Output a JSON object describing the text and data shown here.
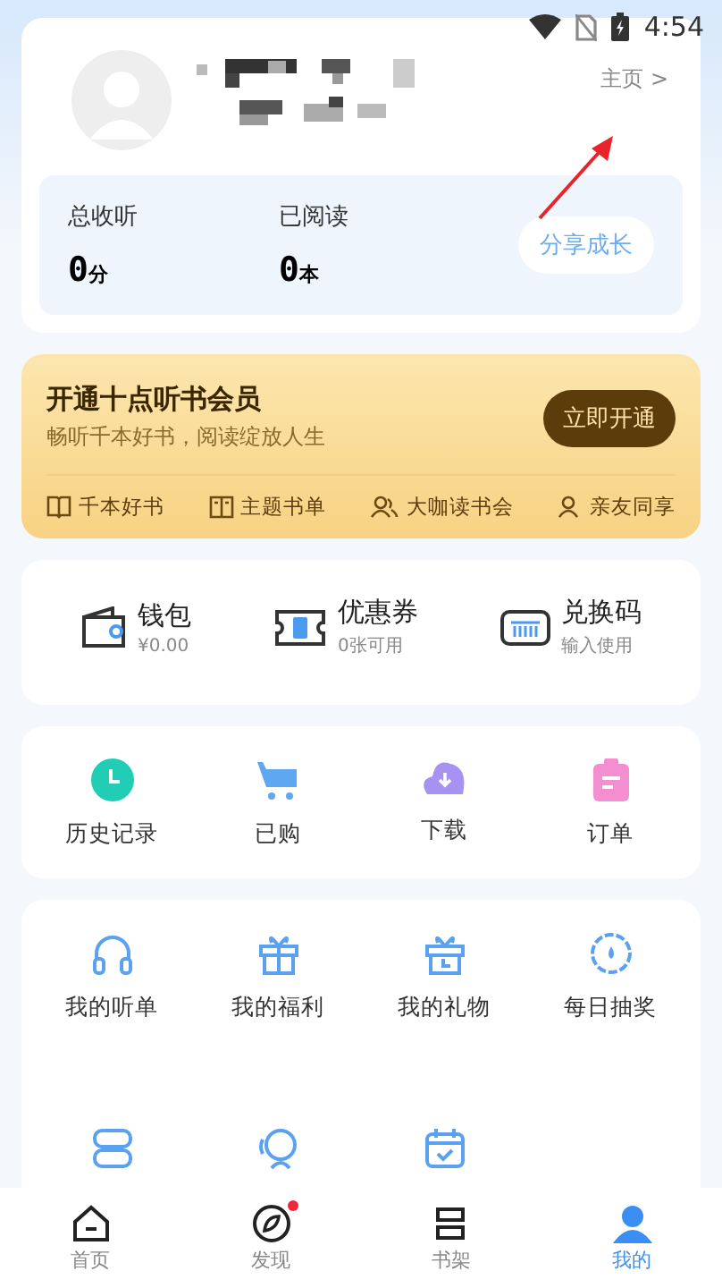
{
  "status_bar": {
    "time": "4:54"
  },
  "profile": {
    "home_link": "主页",
    "home_chevron": ">",
    "stats": [
      {
        "label": "总收听",
        "value": "0",
        "unit": "分"
      },
      {
        "label": "已阅读",
        "value": "0",
        "unit": "本"
      }
    ],
    "share_button": "分享成长"
  },
  "annotation_arrow": true,
  "vip": {
    "title": "开通十点听书会员",
    "subtitle": "畅听千本好书，阅读绽放人生",
    "button": "立即开通",
    "benefits": [
      {
        "kind": "book",
        "label": "千本好书"
      },
      {
        "kind": "list",
        "label": "主题书单"
      },
      {
        "kind": "people",
        "label": "大咖读书会"
      },
      {
        "kind": "person",
        "label": "亲友同享"
      }
    ]
  },
  "wallet": [
    {
      "kind": "wallet",
      "title": "钱包",
      "subtitle": "¥0.00"
    },
    {
      "kind": "coupon",
      "title": "优惠券",
      "subtitle": "0张可用"
    },
    {
      "kind": "code",
      "title": "兑换码",
      "subtitle": "输入使用"
    }
  ],
  "quick": [
    {
      "kind": "clock",
      "label": "历史记录",
      "color": "#22cdb6"
    },
    {
      "kind": "cart",
      "label": "已购",
      "color": "#5ea8f2"
    },
    {
      "kind": "download",
      "label": "下载",
      "color": "#a692f0"
    },
    {
      "kind": "clipboard",
      "label": "订单",
      "color": "#f38fd0"
    }
  ],
  "grid": [
    {
      "kind": "headphones",
      "label": "我的听单"
    },
    {
      "kind": "gift",
      "label": "我的福利"
    },
    {
      "kind": "giftclock",
      "label": "我的礼物"
    },
    {
      "kind": "wheel",
      "label": "每日抽奖"
    },
    {
      "kind": "box"
    },
    {
      "kind": "head"
    },
    {
      "kind": "calendar"
    }
  ],
  "nav": [
    {
      "kind": "home",
      "label": "首页",
      "selected": false,
      "badge": false
    },
    {
      "kind": "compass",
      "label": "发现",
      "selected": false,
      "badge": true
    },
    {
      "kind": "shelf",
      "label": "书架",
      "selected": false,
      "badge": false
    },
    {
      "kind": "me",
      "label": "我的",
      "selected": true,
      "badge": false
    }
  ]
}
